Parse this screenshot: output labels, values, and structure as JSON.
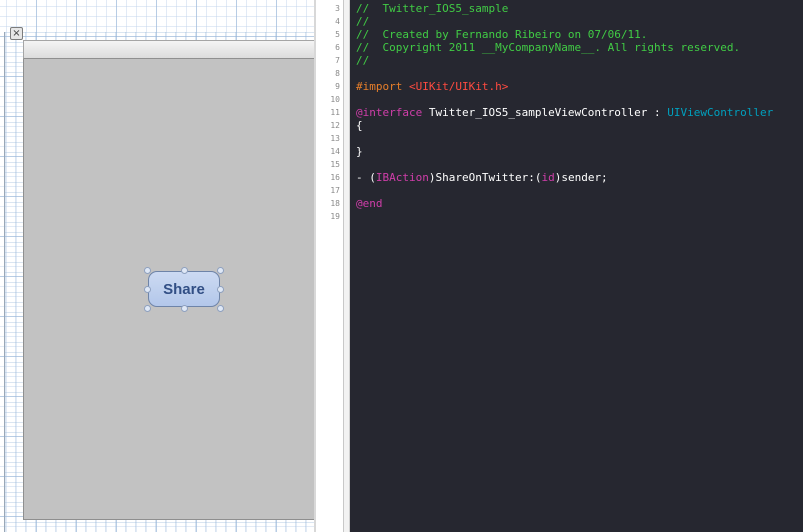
{
  "ib": {
    "close_glyph": "×",
    "button_label": "Share"
  },
  "editor": {
    "line_numbers": [
      "3",
      "4",
      "5",
      "6",
      "7",
      "8",
      "9",
      "10",
      "11",
      "12",
      "13",
      "14",
      "15",
      "16",
      "17",
      "18",
      "19"
    ],
    "lines": {
      "l3": "//  Twitter_IOS5_sample",
      "l4": "//",
      "l5": "//  Created by Fernando Ribeiro on 07/06/11.",
      "l6": "//  Copyright 2011 __MyCompanyName__. All rights reserved.",
      "l7": "//",
      "l9_directive": "#import ",
      "l9_path": "<UIKit/UIKit.h>",
      "l11_kw": "@interface",
      "l11_name": " Twitter_IOS5_sampleViewController : ",
      "l11_super": "UIViewController",
      "l12": "{",
      "l14": "}",
      "l16_prefix": "- (",
      "l16_ibaction": "IBAction",
      "l16_method": ")ShareOnTwitter:(",
      "l16_id": "id",
      "l16_sender": ")sender;",
      "l18": "@end"
    }
  }
}
